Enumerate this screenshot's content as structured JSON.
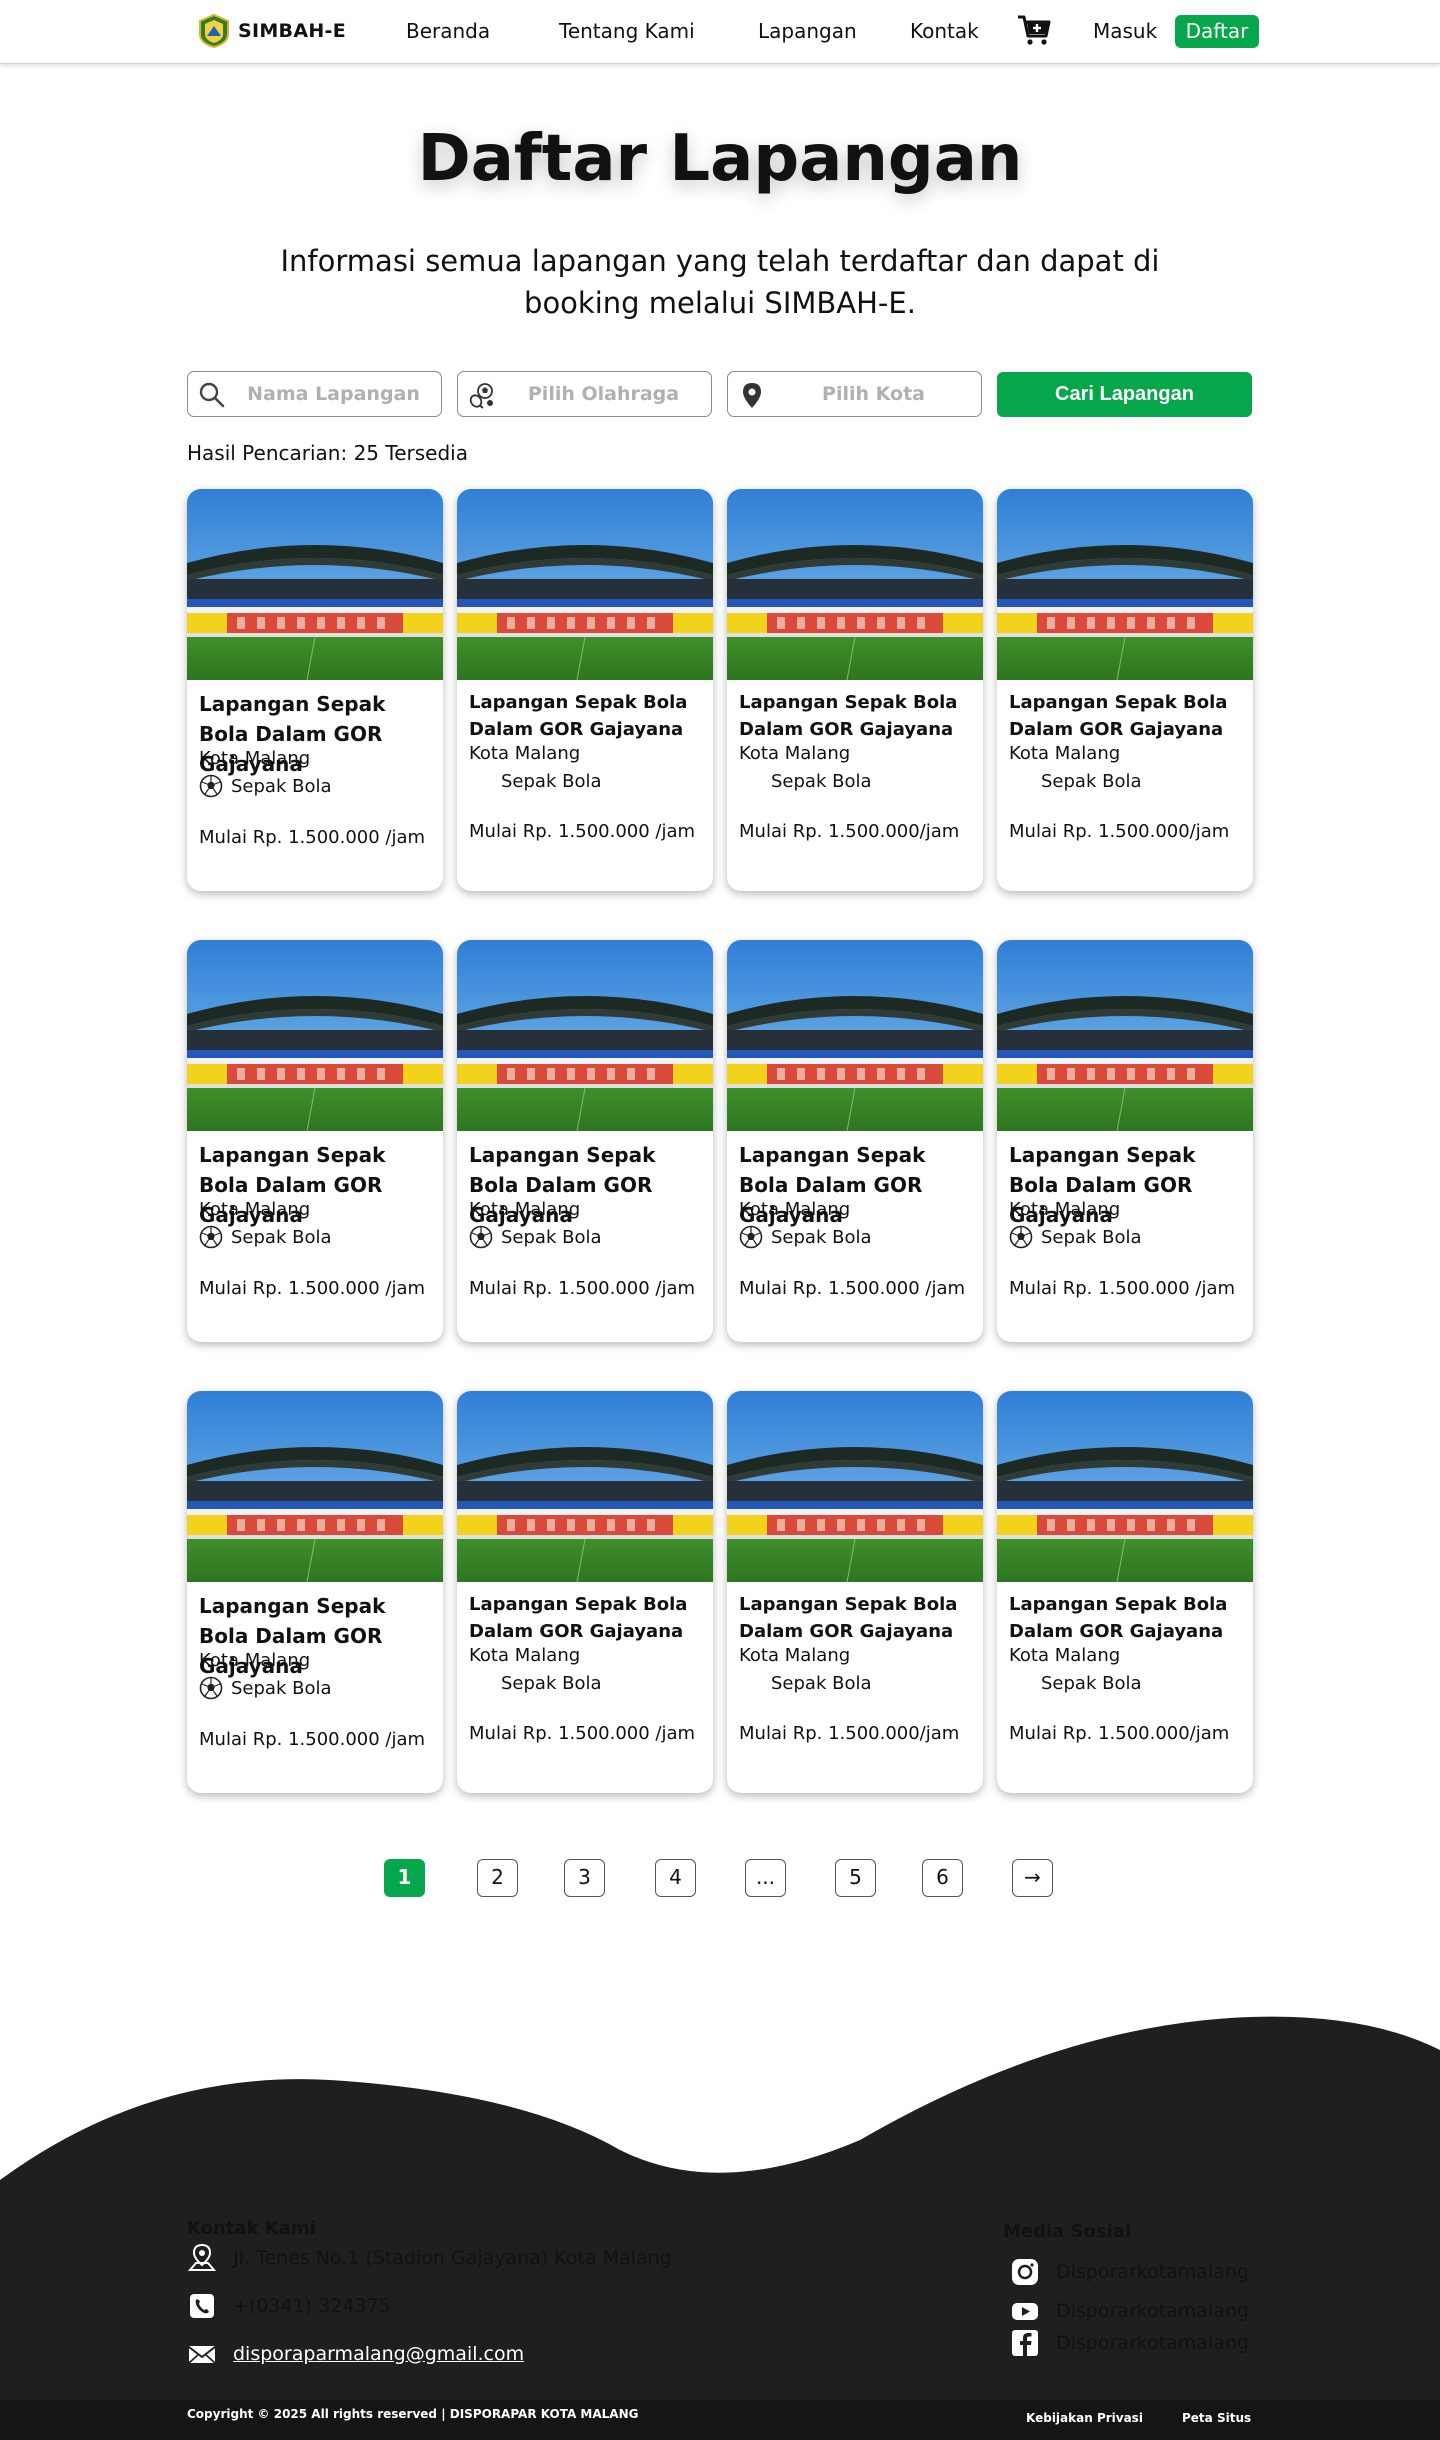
{
  "nav": {
    "brand": "SIMBAH-E",
    "links": [
      "Beranda",
      "Tentang Kami",
      "Lapangan",
      "Kontak"
    ],
    "login": "Masuk",
    "register": "Daftar"
  },
  "hero": {
    "title": "Daftar Lapangan",
    "subtitle_line1": "Informasi semua lapangan yang telah terdaftar dan dapat di",
    "subtitle_line2": "booking melalui SIMBAH-E."
  },
  "search": {
    "name_placeholder": "Nama Lapangan",
    "sport_placeholder": "Pilih Olahraga",
    "city_placeholder": "Pilih Kota",
    "button": "Cari Lapangan",
    "results": "Hasil Pencarian: 25 Tersedia"
  },
  "cards": [
    {
      "title": "Lapangan Sepak Bola Dalam GOR Gajayana",
      "city": "Kota Malang",
      "sport": "Sepak Bola",
      "price": "Mulai Rp. 1.500.000 /jam"
    },
    {
      "title": "Lapangan Sepak Bola Dalam GOR Gajayana",
      "city": "Kota Malang",
      "sport": "Sepak Bola",
      "price": "Mulai Rp. 1.500.000 /jam"
    },
    {
      "title": "Lapangan Sepak Bola Dalam GOR Gajayana",
      "city": "Kota Malang",
      "sport": "Sepak Bola",
      "price": "Mulai Rp. 1.500.000/jam"
    },
    {
      "title": "Lapangan Sepak Bola Dalam GOR Gajayana",
      "city": "Kota Malang",
      "sport": "Sepak Bola",
      "price": "Mulai Rp. 1.500.000/jam"
    },
    {
      "title": "Lapangan Sepak Bola Dalam GOR Gajayana",
      "city": "Kota Malang",
      "sport": "Sepak Bola",
      "price": "Mulai Rp. 1.500.000 /jam"
    },
    {
      "title": "Lapangan Sepak Bola Dalam GOR Gajayana",
      "city": "Kota Malang",
      "sport": "Sepak Bola",
      "price": "Mulai Rp. 1.500.000 /jam"
    },
    {
      "title": "Lapangan Sepak Bola Dalam GOR Gajayana",
      "city": "Kota Malang",
      "sport": "Sepak Bola",
      "price": "Mulai Rp. 1.500.000 /jam"
    },
    {
      "title": "Lapangan Sepak Bola Dalam GOR Gajayana",
      "city": "Kota Malang",
      "sport": "Sepak Bola",
      "price": "Mulai Rp. 1.500.000 /jam"
    },
    {
      "title": "Lapangan Sepak Bola Dalam GOR Gajayana",
      "city": "Kota Malang",
      "sport": "Sepak Bola",
      "price": "Mulai Rp. 1.500.000 /jam"
    },
    {
      "title": "Lapangan Sepak Bola Dalam GOR Gajayana",
      "city": "Kota Malang",
      "sport": "Sepak Bola",
      "price": "Mulai Rp. 1.500.000 /jam"
    },
    {
      "title": "Lapangan Sepak Bola Dalam GOR Gajayana",
      "city": "Kota Malang",
      "sport": "Sepak Bola",
      "price": "Mulai Rp. 1.500.000/jam"
    },
    {
      "title": "Lapangan Sepak Bola Dalam GOR Gajayana",
      "city": "Kota Malang",
      "sport": "Sepak Bola",
      "price": "Mulai Rp. 1.500.000/jam"
    }
  ],
  "pagination": [
    "1",
    "2",
    "3",
    "4",
    "...",
    "5",
    "6",
    "→"
  ],
  "footer": {
    "contact_heading": "Kontak Kami",
    "address": "Jl. Tenes No.1 (Stadion Gajayana) Kota Malang",
    "phone": "+(0341) 324375",
    "email": "disporaparmalang@gmail.com",
    "social_heading": "Media Sosial",
    "instagram": "Disporarkotamalang",
    "youtube": "Disporarkotamalang",
    "facebook": "Disporarkotamalang",
    "copyright": "Copyright © 2025 All rights reserved | DISPORAPAR KOTA MALANG",
    "privacy": "Kebijakan Privasi",
    "sitemap": "Peta Situs"
  },
  "colors": {
    "accent": "#06a64a",
    "footer_bg": "#1f1f1f"
  }
}
